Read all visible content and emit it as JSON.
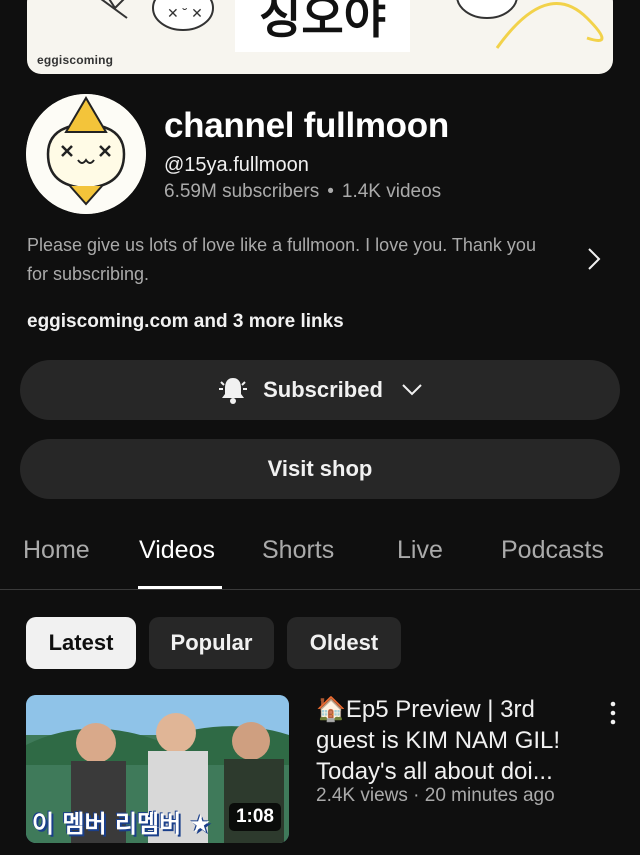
{
  "banner": {
    "brand": "eggiscoming",
    "korean_text": "싱오야"
  },
  "channel": {
    "name": "channel fullmoon",
    "handle": "@15ya.fullmoon",
    "subscribers": "6.59M subscribers",
    "separator": "•",
    "videos": "1.4K videos",
    "description": "Please give us lots of love like a fullmoon. I love you. Thank you for subscribing.",
    "links": "eggiscoming.com and 3 more links"
  },
  "buttons": {
    "subscribed": "Subscribed",
    "visit_shop": "Visit shop"
  },
  "tabs": [
    {
      "label": "Home",
      "active": false
    },
    {
      "label": "Videos",
      "active": true
    },
    {
      "label": "Shorts",
      "active": false
    },
    {
      "label": "Live",
      "active": false
    },
    {
      "label": "Podcasts",
      "active": false
    }
  ],
  "filters": [
    {
      "label": "Latest",
      "active": true
    },
    {
      "label": "Popular",
      "active": false
    },
    {
      "label": "Oldest",
      "active": false
    }
  ],
  "video": {
    "title": "🏠Ep5 Preview | 3rd guest is KIM NAM GIL! Today's all about doi...",
    "meta": "2.4K views · 20 minutes ago",
    "duration": "1:08",
    "thumb_caption": "이 멤버 리멤버 ★"
  },
  "colors": {
    "background": "#0f0f0f",
    "button": "#272727",
    "text_primary": "#f1f1f1",
    "text_secondary": "#aaaaaa"
  },
  "icons": [
    "bell-ringing-icon",
    "chevron-down-icon",
    "chevron-right-icon",
    "more-vert-icon"
  ]
}
